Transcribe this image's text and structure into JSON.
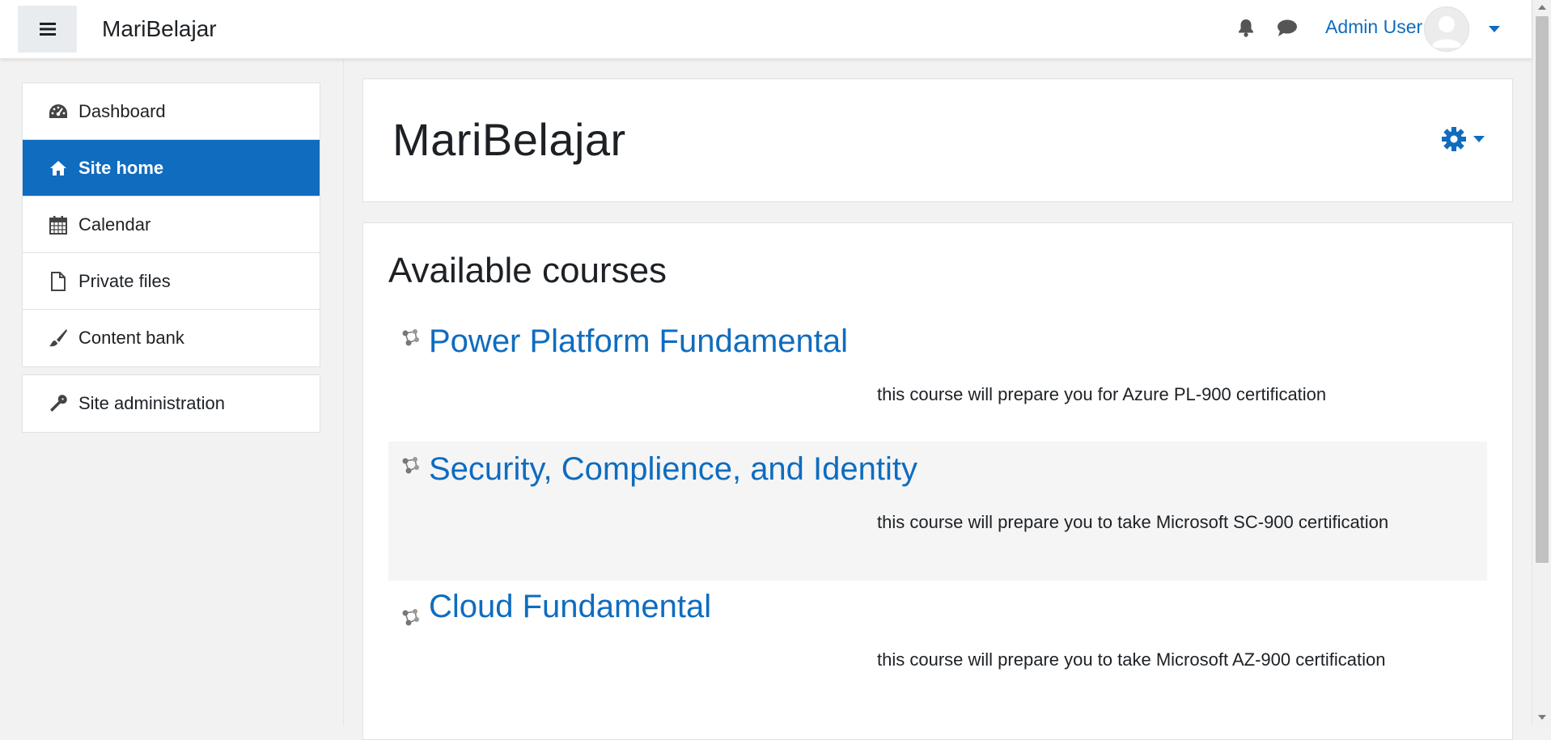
{
  "navbar": {
    "brand": "MariBelajar",
    "user_name": "Admin User",
    "icons": [
      "menu-icon",
      "bell-icon",
      "chat-icon",
      "avatar",
      "caret-down-icon"
    ]
  },
  "sidebar": {
    "items": [
      {
        "label": "Dashboard",
        "icon": "dashboard-icon",
        "active": false
      },
      {
        "label": "Site home",
        "icon": "home-icon",
        "active": true
      },
      {
        "label": "Calendar",
        "icon": "calendar-icon",
        "active": false
      },
      {
        "label": "Private files",
        "icon": "file-icon",
        "active": false
      },
      {
        "label": "Content bank",
        "icon": "brush-icon",
        "active": false
      }
    ],
    "admin_items": [
      {
        "label": "Site administration",
        "icon": "wrench-icon"
      }
    ]
  },
  "main": {
    "page_title": "MariBelajar",
    "settings_icon": "gear-icon",
    "section_title": "Available courses",
    "courses": [
      {
        "name": "Power Platform Fundamental",
        "summary": "this course will prepare you for Azure PL-900 certification"
      },
      {
        "name": "Security, Complience, and Identity",
        "summary": "this course will prepare you to take Microsoft SC-900 certification"
      },
      {
        "name": "Cloud Fundamental",
        "summary": "this course will prepare you to take Microsoft AZ-900 certification"
      }
    ]
  },
  "colors": {
    "accent": "#0f6cbf",
    "background": "#f2f2f2",
    "alt_row": "#f5f5f5"
  }
}
